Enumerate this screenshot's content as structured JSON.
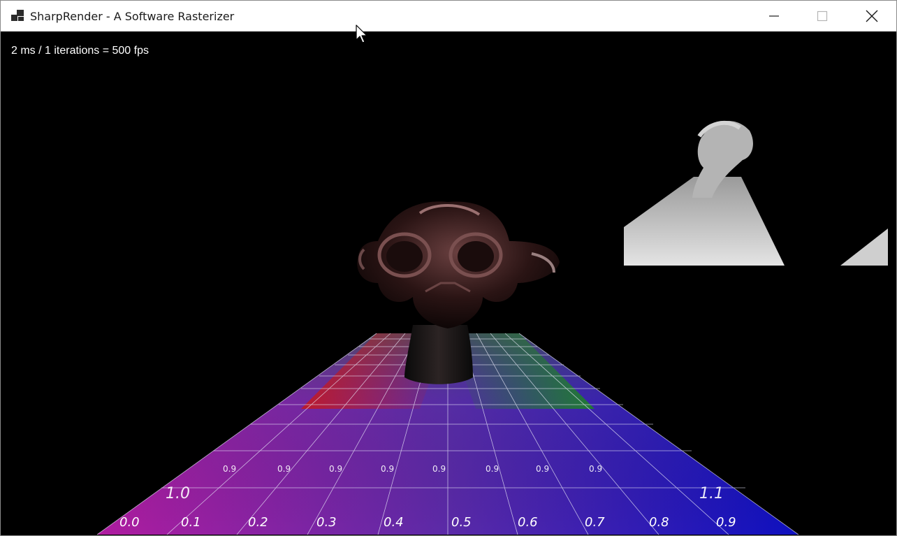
{
  "window": {
    "title": "SharpRender - A Software Rasterizer",
    "buttons": [
      "minimize",
      "maximize",
      "close"
    ]
  },
  "viewport": {
    "fps_text": "2 ms / 1 iterations = 500 fps",
    "background_color": "#000000"
  },
  "scene": {
    "floor_labels_row1": [
      "0.0",
      "0.1",
      "0.2",
      "0.3",
      "0.4",
      "0.5",
      "0.6",
      "0.7",
      "0.8",
      "0.9"
    ],
    "floor_labels_row2": [
      "1.0",
      "0.9",
      "0.9",
      "0.9",
      "0.9",
      "0.9",
      "0.9",
      "0.9",
      "0.9",
      "1.1"
    ],
    "colors": {
      "floor_left": "#a0209a",
      "floor_right": "#1010b8",
      "floor_back_left": "#c01818",
      "floor_back_right": "#1a7a1a",
      "shadow_panel": "#d8d8d8"
    }
  },
  "icons": [
    "app-icon",
    "minimize-icon",
    "maximize-icon",
    "close-icon",
    "mouse-cursor-icon"
  ]
}
